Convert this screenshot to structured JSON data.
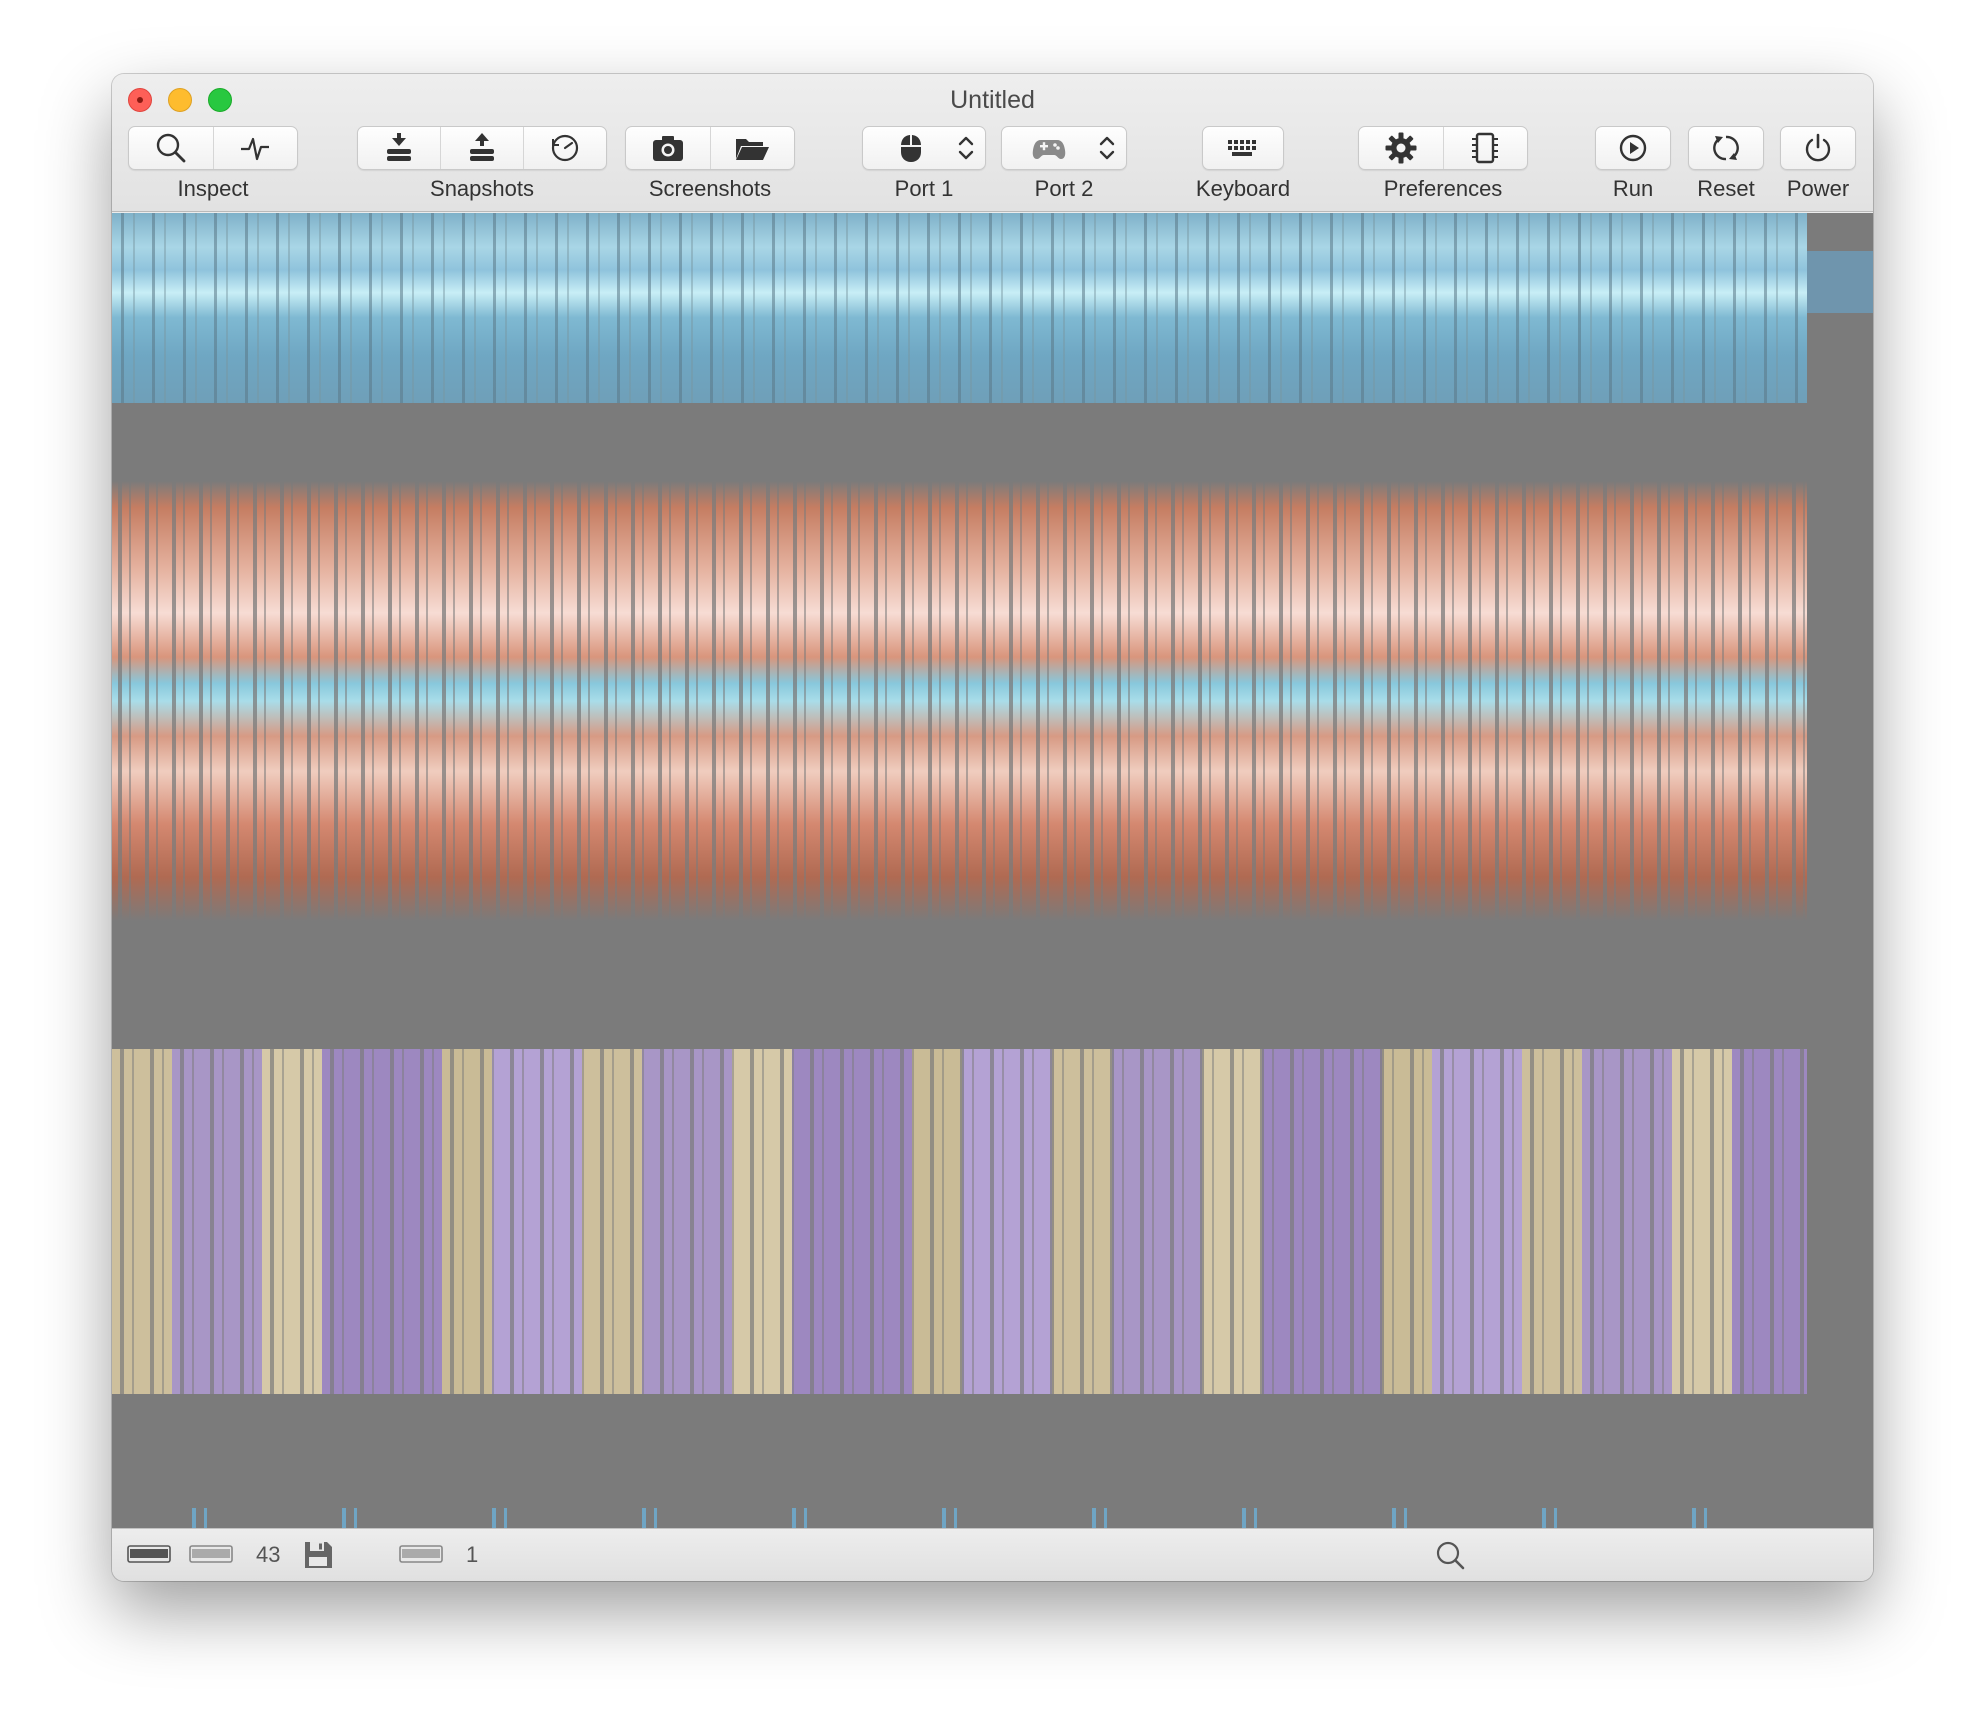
{
  "window": {
    "title": "Untitled"
  },
  "toolbar": {
    "groups": [
      {
        "label": "Inspect",
        "icons": [
          "magnifier-icon",
          "waveform-icon"
        ]
      },
      {
        "label": "Snapshots",
        "icons": [
          "snapshot-save-icon",
          "snapshot-restore-icon",
          "snapshot-timer-icon"
        ]
      },
      {
        "label": "Screenshots",
        "icons": [
          "camera-icon",
          "folder-icon"
        ]
      },
      {
        "label": "Port 1",
        "icons": [
          "mouse-icon",
          "updown-chevron-icon"
        ]
      },
      {
        "label": "Port 2",
        "icons": [
          "gamepad-icon",
          "updown-chevron-icon"
        ]
      },
      {
        "label": "Keyboard",
        "icons": [
          "keyboard-icon"
        ]
      },
      {
        "label": "Preferences",
        "icons": [
          "gear-icon",
          "chip-icon"
        ]
      },
      {
        "label": "Run",
        "icons": [
          "play-icon"
        ]
      },
      {
        "label": "Reset",
        "icons": [
          "reset-icon"
        ]
      },
      {
        "label": "Power",
        "icons": [
          "power-icon"
        ]
      }
    ]
  },
  "statusbar": {
    "drive_count": "43",
    "disk_count": "1",
    "icons": [
      "drive-led-icon",
      "drive-icon",
      "disk-save-icon",
      "cartridge-icon",
      "zoom-icon"
    ]
  },
  "colors": {
    "screen_background": "#7b7b7b",
    "band_cyan": "#8fc3dc",
    "band_orange": "#d9957c",
    "band_purple": "#a896c6",
    "band_tan": "#cdbf9c"
  }
}
